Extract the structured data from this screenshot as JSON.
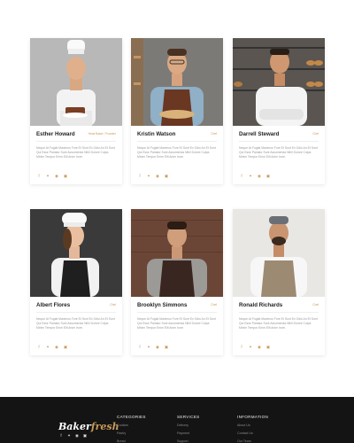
{
  "team": [
    {
      "name": "Esther Howard",
      "role": "Head Baker / Founder",
      "bio": "Neque At Fugiat Maximus Fore Et Sunt Ex Odio An Et Sunt Qui Esse Pariatur Sunt Assumenda Nihil Dolore Culpa Minim Tempor Enim Elit Anim Irure."
    },
    {
      "name": "Kristin Watson",
      "role": "Chef",
      "bio": "Neque At Fugiat Maximus Fore Et Sunt Ex Odio An Et Sunt Qui Esse Pariatur Sunt Assumenda Nihil Dolore Culpa Minim Tempor Enim Elit Anim Irure."
    },
    {
      "name": "Darrell Steward",
      "role": "Chef",
      "bio": "Neque At Fugiat Maximus Fore Et Sunt Ex Odio An Et Sunt Qui Esse Pariatur Sunt Assumenda Nihil Dolore Culpa Minim Tempor Enim Elit Anim Irure."
    },
    {
      "name": "Albert Flores",
      "role": "Chef",
      "bio": "Neque At Fugiat Maximus Fore Et Sunt Ex Odio An Et Sunt Qui Esse Pariatur Sunt Assumenda Nihil Dolore Culpa Minim Tempor Enim Elit Anim Irure."
    },
    {
      "name": "Brooklyn Simmons",
      "role": "Chef",
      "bio": "Neque At Fugiat Maximus Fore Et Sunt Ex Odio An Et Sunt Qui Esse Pariatur Sunt Assumenda Nihil Dolore Culpa Minim Tempor Enim Elit Anim Irure."
    },
    {
      "name": "Ronald Richards",
      "role": "Chef",
      "bio": "Neque At Fugiat Maximus Fore Et Sunt Ex Odio An Et Sunt Qui Esse Pariatur Sunt Assumenda Nihil Dolore Culpa Minim Tempor Enim Elit Anim Irure."
    }
  ],
  "social_icons": [
    "facebook-icon",
    "twitter-icon",
    "pinterest-icon",
    "instagram-icon"
  ],
  "footer": {
    "logo_main": "Baker",
    "logo_accent": "fresh",
    "categories_heading": "CATEGORIES",
    "categories_links": [
      "Cookies",
      "Pastry",
      "Bread"
    ],
    "services_heading": "SERVICES",
    "services_links": [
      "Delivery",
      "Payment",
      "Support"
    ],
    "information_heading": "INFORMATION",
    "information_links": [
      "About Us",
      "Contact Us",
      "Our Team"
    ]
  },
  "colors": {
    "accent": "#c89a5a",
    "footer_bg": "#141414"
  }
}
